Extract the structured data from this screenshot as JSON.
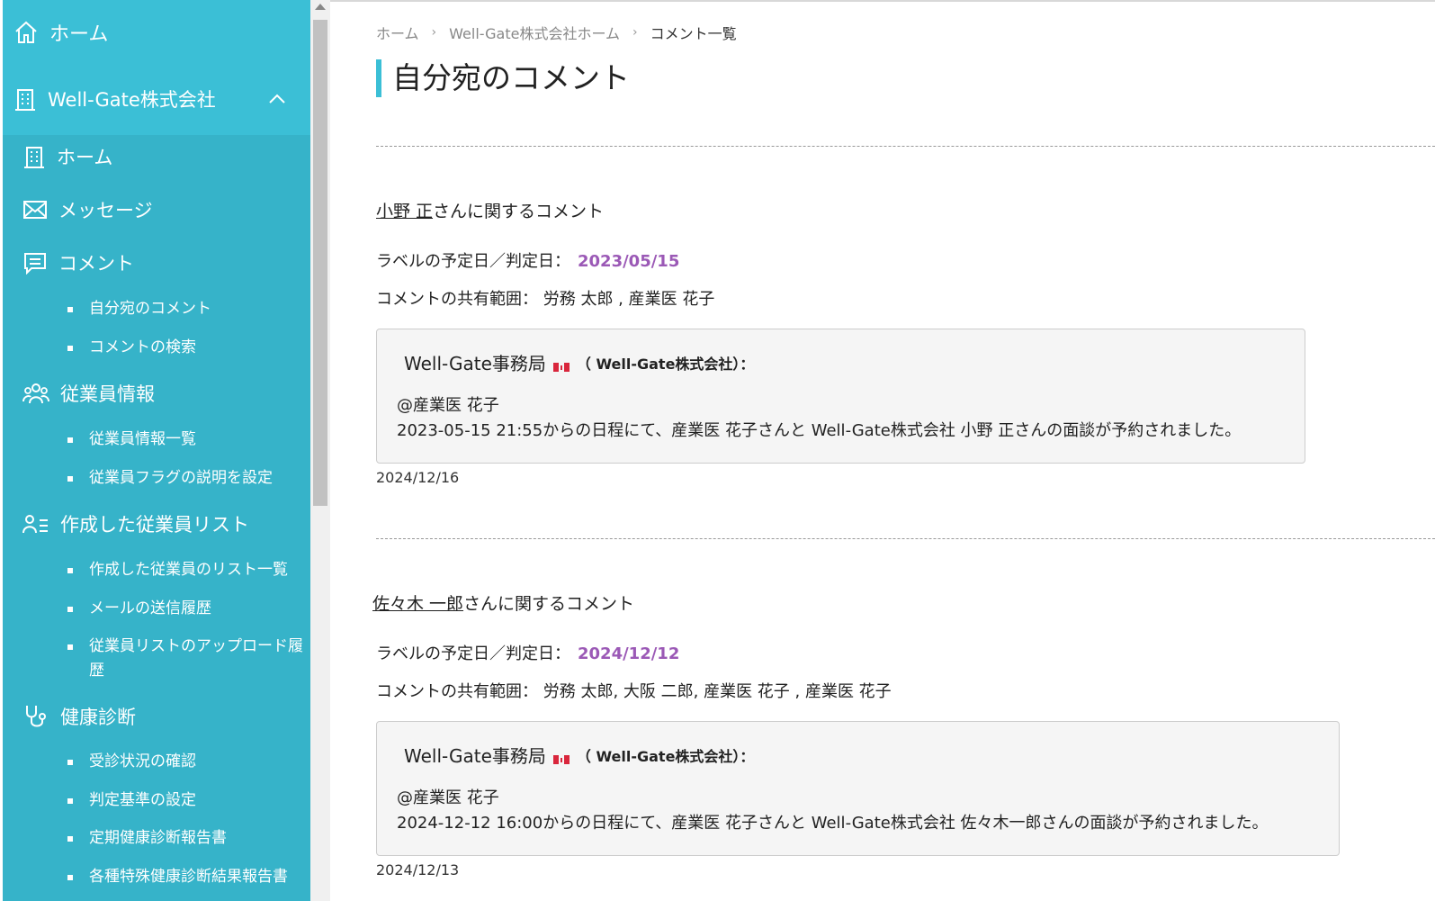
{
  "sidebar": {
    "top_home": "ホーム",
    "company": "Well-Gate株式会社",
    "items": {
      "home": "ホーム",
      "message": "メッセージ",
      "comment": "コメント",
      "comment_sub": [
        "自分宛のコメント",
        "コメントの検索"
      ],
      "employee": "従業員情報",
      "employee_sub": [
        "従業員情報一覧",
        "従業員フラグの説明を設定"
      ],
      "list": "作成した従業員リスト",
      "list_sub": [
        "作成した従業員のリスト一覧",
        "メールの送信履歴",
        "従業員リストのアップロード履歴"
      ],
      "health": "健康診断",
      "health_sub": [
        "受診状況の確認",
        "判定基準の設定",
        "定期健康診断報告書",
        "各種特殊健康診断結果報告書"
      ]
    }
  },
  "breadcrumb": [
    "ホーム",
    "Well-Gate株式会社ホーム",
    "コメント一覧"
  ],
  "page_title": "自分宛のコメント",
  "comments": [
    {
      "person": "小野 正",
      "head_suffix": "さんに関するコメント",
      "label_date_caption": "ラベルの予定日／判定日：",
      "label_date": "2023/05/15",
      "share_caption": "コメントの共有範囲：",
      "share": "労務 太郎 , 産業医 花子",
      "author": "Well-Gate事務局",
      "org": "（ Well-Gate株式会社）：",
      "mention": "@産業医 花子",
      "message": "2023-05-15 21:55からの日程にて、産業医 花子さんと Well-Gate株式会社 小野 正さんの面談が予約されました。",
      "posted": "2024/12/16"
    },
    {
      "person": "佐々木 一郎",
      "head_suffix": "さんに関するコメント",
      "label_date_caption": "ラベルの予定日／判定日：",
      "label_date": "2024/12/12",
      "share_caption": "コメントの共有範囲：",
      "share": "労務 太郎, 大阪 二郎, 産業医 花子 , 産業医 花子",
      "author": "Well-Gate事務局",
      "org": "（ Well-Gate株式会社）：",
      "mention": "@産業医 花子",
      "message": "2024-12-12 16:00からの日程にて、産業医 花子さんと Well-Gate株式会社 佐々木一郎さんの面談が予約されました。",
      "posted": "2024/12/13"
    }
  ],
  "colors": {
    "sidebar": "#36b3c9",
    "sidebar_top": "#3bbfd6",
    "accent": "#3bbfd6",
    "date": "#9b59b6"
  }
}
